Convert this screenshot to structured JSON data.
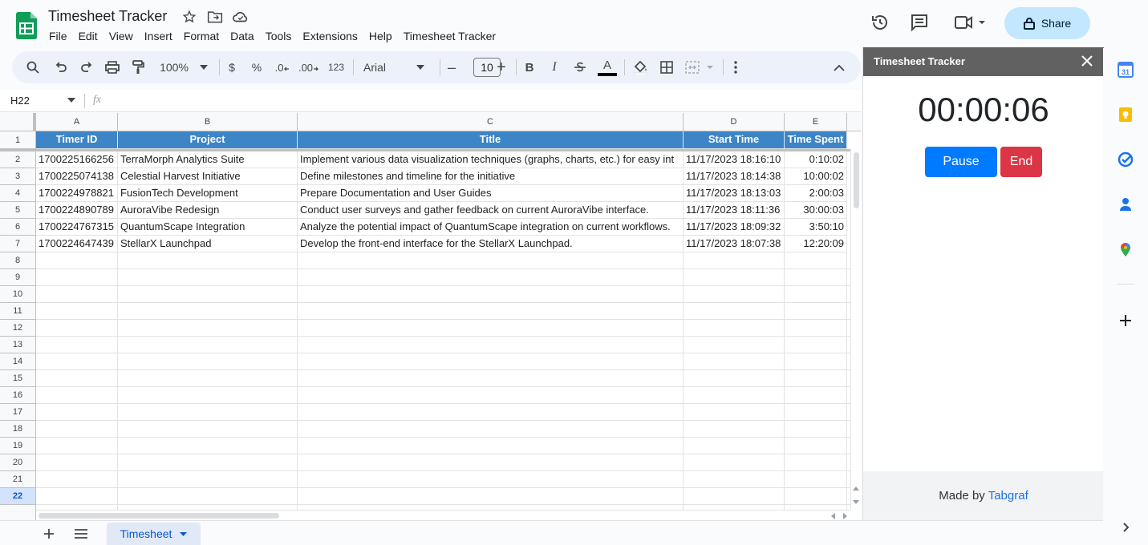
{
  "app": {
    "title": "Timesheet Tracker",
    "menu": [
      "File",
      "Edit",
      "View",
      "Insert",
      "Format",
      "Data",
      "Tools",
      "Extensions",
      "Help",
      "Timesheet Tracker"
    ],
    "share_label": "Share"
  },
  "toolbar": {
    "zoom": "100%",
    "currency": "$",
    "percent": "%",
    "decrease_decimal": ".0",
    "increase_decimal": ".00",
    "number_format": "123",
    "font": "Arial",
    "font_size": "10",
    "minus": "–",
    "plus": "+",
    "bold": "B",
    "italic": "I",
    "text_color_letter": "A"
  },
  "formula_bar": {
    "name_box": "H22",
    "fx": "fx"
  },
  "grid": {
    "columns": [
      "A",
      "B",
      "C",
      "D",
      "E"
    ],
    "header_row": [
      "Timer ID",
      "Project",
      "Title",
      "Start Time",
      "Time Spent"
    ],
    "rows": [
      [
        "1700225166256",
        "TerraMorph Analytics Suite",
        "Implement various data visualization techniques (graphs, charts, etc.) for easy int",
        "11/17/2023 18:16:10",
        "0:10:02"
      ],
      [
        "1700225074138",
        "Celestial Harvest Initiative",
        "Define milestones and timeline for the initiative",
        "11/17/2023 18:14:38",
        "10:00:02"
      ],
      [
        "1700224978821",
        "FusionTech Development",
        "Prepare Documentation and User Guides",
        "11/17/2023 18:13:03",
        "2:00:03"
      ],
      [
        "1700224890789",
        "AuroraVibe Redesign",
        "Conduct user surveys and gather feedback on current AuroraVibe interface.",
        "11/17/2023 18:11:36",
        "30:00:03"
      ],
      [
        "1700224767315",
        "QuantumScape Integration",
        "Analyze the potential impact of QuantumScape integration on current workflows.",
        "11/17/2023 18:09:32",
        "3:50:10"
      ],
      [
        "1700224647439",
        "StellarX Launchpad",
        "Develop the front-end interface for the StellarX Launchpad.",
        "11/17/2023 18:07:38",
        "12:20:09"
      ]
    ],
    "row_numbers": [
      "1",
      "2",
      "3",
      "4",
      "5",
      "6",
      "7",
      "8",
      "9",
      "10",
      "11",
      "12",
      "13",
      "14",
      "15",
      "16",
      "17",
      "18",
      "19",
      "20",
      "21",
      "22"
    ],
    "selected_row": "22"
  },
  "sheet_tab": {
    "name": "Timesheet"
  },
  "panel": {
    "title": "Timesheet Tracker",
    "timer": "00:00:06",
    "pause_label": "Pause",
    "end_label": "End",
    "footer_prefix": "Made by",
    "footer_link": "Tabgraf"
  },
  "colors": {
    "header_fill": "#3d85c6",
    "pause": "#007bff",
    "end": "#dc3545",
    "share": "#c2e7ff"
  }
}
